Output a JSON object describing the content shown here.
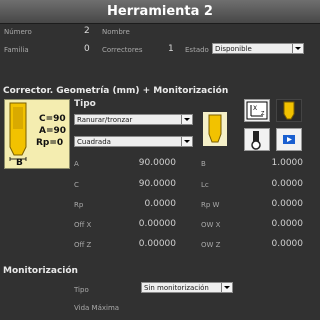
{
  "window": {
    "title": "Herramienta 2"
  },
  "header": {
    "numero_label": "Número",
    "numero_value": "2",
    "nombre_label": "Nombre",
    "familia_label": "Familia",
    "familia_value": "0",
    "correctores_label": "Correctores",
    "correctores_value": "1",
    "estado_label": "Estado",
    "estado_value": "Disponible"
  },
  "corrector": {
    "section_title": "Corrector. Geometría (mm) + Monitorización",
    "tool_preview": {
      "c": "C=90",
      "a": "A=90",
      "rp": "Rp=0",
      "b": "B"
    },
    "tipo_label": "Tipo",
    "tipo_value": "Ranurar/tronzar",
    "forma_value": "Cuadrada",
    "left_params": [
      {
        "label": "A",
        "value": "90.0000"
      },
      {
        "label": "C",
        "value": "90.0000"
      },
      {
        "label": "Rp",
        "value": "0.0000"
      },
      {
        "label": "Off X",
        "value": "0.00000"
      },
      {
        "label": "Off Z",
        "value": "0.00000"
      }
    ],
    "right_params": [
      {
        "label": "B",
        "value": "1.0000"
      },
      {
        "label": "Lc",
        "value": "0.0000"
      },
      {
        "label": "Rp W",
        "value": "0.0000"
      },
      {
        "label": "OW X",
        "value": "0.0000"
      },
      {
        "label": "OW Z",
        "value": "0.0000"
      }
    ]
  },
  "monitorizacion": {
    "section_title": "Monitorización",
    "tipo_label": "Tipo",
    "tipo_value": "Sin monitorización",
    "vida_label": "Vida Máxima"
  },
  "colors": {
    "background": "#313131",
    "tool_yellow": "#f2c200",
    "accent_blue": "#1a5fd0"
  }
}
